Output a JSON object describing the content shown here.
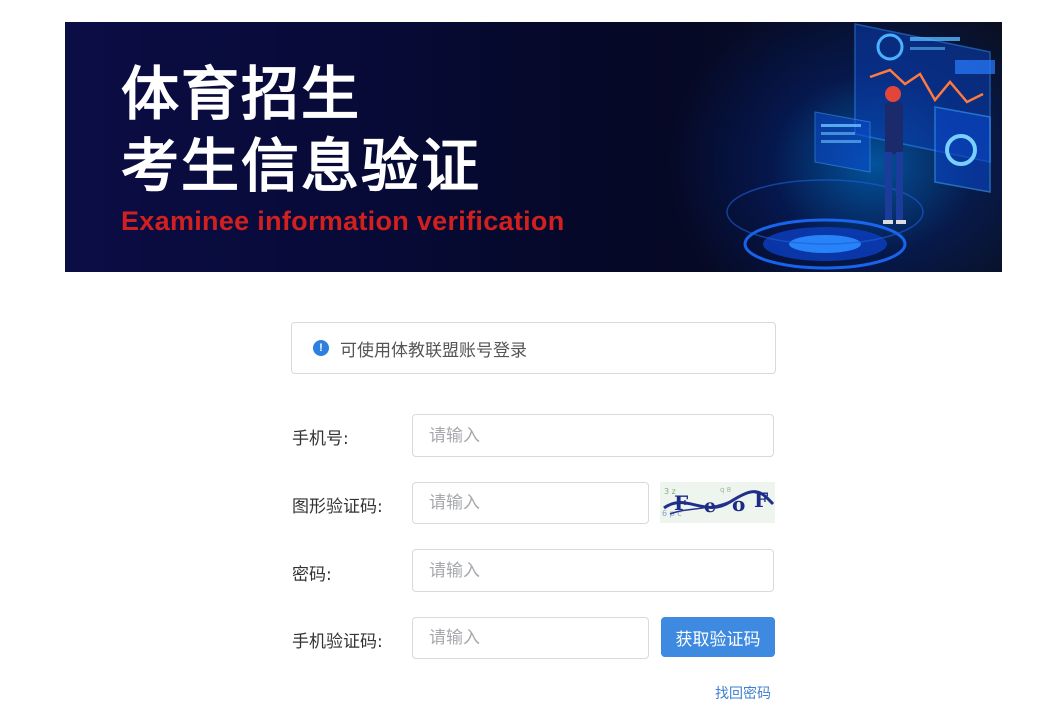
{
  "banner": {
    "title_line1": "体育招生",
    "title_line2": "考生信息验证",
    "subtitle": "Examinee information verification"
  },
  "notice": {
    "icon": "info-icon",
    "icon_glyph": "!",
    "text": "可使用体教联盟账号登录"
  },
  "form": {
    "phone": {
      "label": "手机号:",
      "placeholder": "请输入",
      "value": ""
    },
    "image_captcha": {
      "label": "图形验证码:",
      "placeholder": "请输入",
      "value": ""
    },
    "password": {
      "label": "密码:",
      "placeholder": "请输入",
      "value": ""
    },
    "sms_code": {
      "label": "手机验证码:",
      "placeholder": "请输入",
      "value": ""
    },
    "get_code_button": "获取验证码",
    "forgot_password_link": "找回密码"
  },
  "colors": {
    "primary": "#3d8ae0",
    "link": "#3d7fd0",
    "banner_bg": "#070a35",
    "banner_subtitle": "#d0201f",
    "info_icon": "#2f7fe0"
  }
}
